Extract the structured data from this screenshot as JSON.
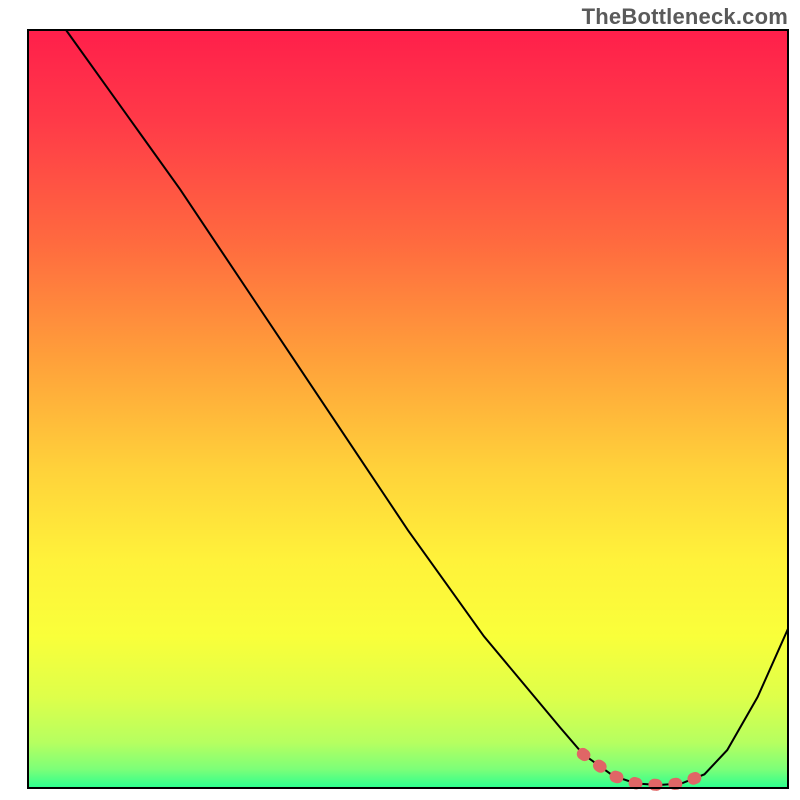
{
  "watermark": "TheBottleneck.com",
  "colors": {
    "frame": "#000000",
    "curve": "#000000",
    "highlight": "#e06666",
    "gradient_stops": [
      {
        "offset": 0.0,
        "color": "#ff1f4b"
      },
      {
        "offset": 0.12,
        "color": "#ff3a48"
      },
      {
        "offset": 0.28,
        "color": "#ff6a3f"
      },
      {
        "offset": 0.44,
        "color": "#ffa23a"
      },
      {
        "offset": 0.58,
        "color": "#ffd23a"
      },
      {
        "offset": 0.7,
        "color": "#fff23a"
      },
      {
        "offset": 0.8,
        "color": "#f9ff3a"
      },
      {
        "offset": 0.88,
        "color": "#deff4a"
      },
      {
        "offset": 0.94,
        "color": "#b6ff60"
      },
      {
        "offset": 0.975,
        "color": "#7dff78"
      },
      {
        "offset": 1.0,
        "color": "#2bff8f"
      }
    ]
  },
  "chart_data": {
    "type": "line",
    "title": "",
    "xlabel": "",
    "ylabel": "",
    "xlim": [
      0,
      100
    ],
    "ylim": [
      0,
      100
    ],
    "description": "Bottleneck severity curve over some swept parameter; background vertical gradient encodes severity (red = high bottleneck, green = none). Curve reaches minimum (best) around x ≈ 77–88.",
    "x": [
      5,
      10,
      15,
      20,
      25,
      30,
      35,
      40,
      45,
      50,
      55,
      60,
      65,
      70,
      73,
      77,
      80,
      83,
      86,
      89,
      92,
      96,
      100
    ],
    "y": [
      100,
      93,
      86,
      79,
      71.5,
      64,
      56.5,
      49,
      41.5,
      34,
      27,
      20,
      14,
      8,
      4.5,
      1.6,
      0.6,
      0.4,
      0.6,
      1.8,
      5,
      12,
      21
    ],
    "highlight_range_x": [
      72,
      90
    ],
    "highlight_note": "flat-bottom sweet-spot region drawn with thick salmon dashed/rounded stroke"
  }
}
